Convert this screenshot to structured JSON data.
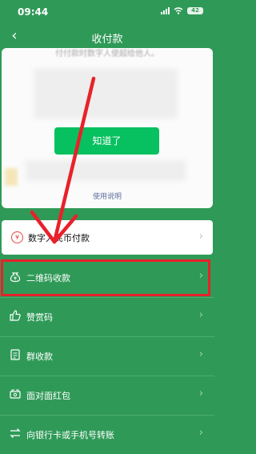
{
  "status_bar": {
    "time": "09:44",
    "battery": "42"
  },
  "nav": {
    "back_glyph": "‹",
    "title": "收付款"
  },
  "card": {
    "blurred_text": "付付款时数字人使超给他人。",
    "got_it_button": "知道了",
    "help_link": "使用说明"
  },
  "menu": {
    "digital_rmb": {
      "label": "数字人民币付款",
      "icon": "yuan-icon"
    },
    "items": [
      {
        "label": "二维码收款",
        "icon": "money-bag-icon"
      },
      {
        "label": "赞赏码",
        "icon": "thumbs-up-icon"
      },
      {
        "label": "群收款",
        "icon": "document-icon"
      },
      {
        "label": "面对面红包",
        "icon": "red-packet-icon"
      },
      {
        "label": "向银行卡或手机号转账",
        "icon": "transfer-icon"
      }
    ],
    "chevron": "›"
  },
  "annotation": {
    "arrow_color": "#e8212b",
    "highlight_color": "#e8212b"
  },
  "colors": {
    "background": "#2f9a57",
    "button": "#07c160"
  }
}
